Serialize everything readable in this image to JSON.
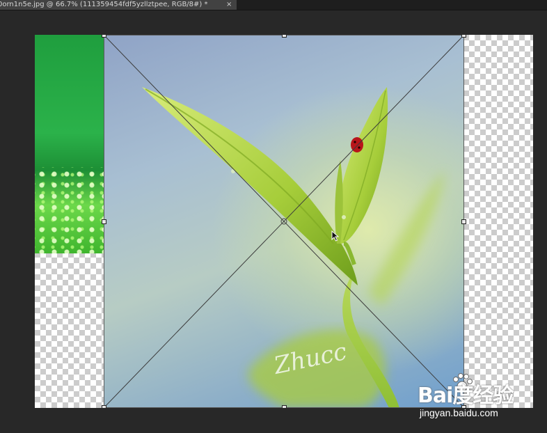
{
  "document_tab": {
    "title": "0orn1n5e.jpg @ 66.7% (111359454fdf5yzllztpee, RGB/8#) *",
    "close_symbol": "×"
  },
  "canvas": {
    "layer_name": "111359454fdf5yzllztpee",
    "zoom": "66.7%",
    "signature_text": "Zhucc"
  },
  "watermark": {
    "logo_text": "Bai度经验",
    "url": "jingyan.baidu.com"
  },
  "icons": [
    "close-icon",
    "transform-handle-icon",
    "arrow-cursor-icon",
    "ladybug-icon"
  ]
}
